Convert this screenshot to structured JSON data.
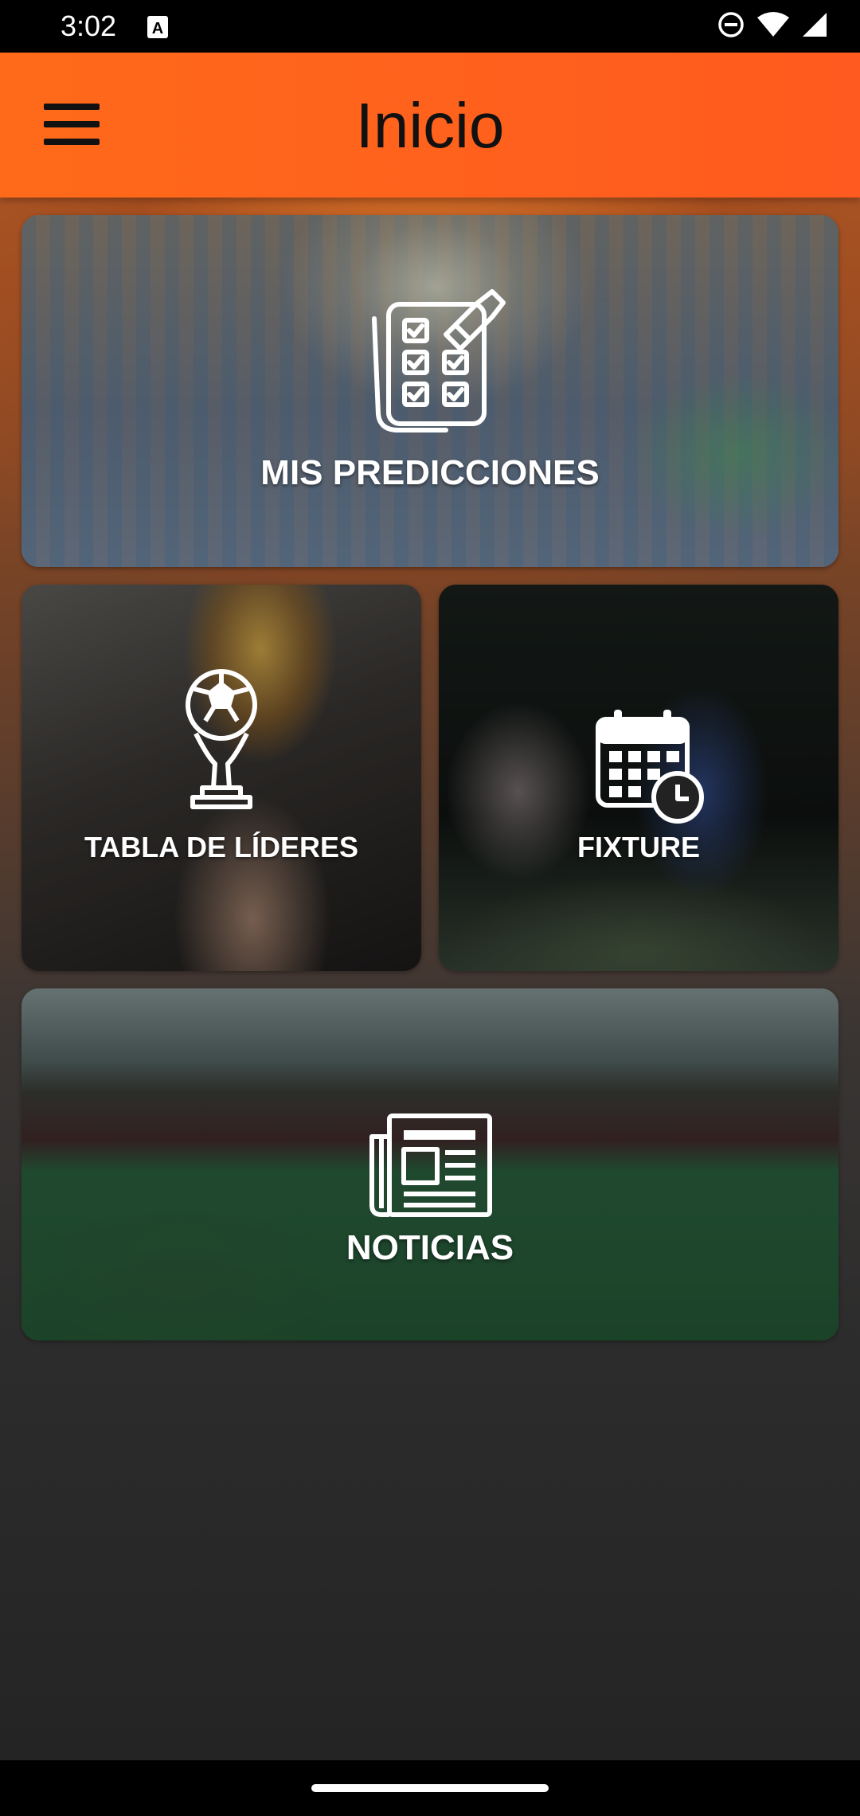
{
  "status_bar": {
    "time": "3:02",
    "icons": [
      "notification-a-icon",
      "do-not-disturb-icon",
      "wifi-icon",
      "signal-icon"
    ]
  },
  "app_bar": {
    "title": "Inicio",
    "menu_icon": "hamburger-menu-icon",
    "background_color": "#ff5a1f"
  },
  "tiles": {
    "predicciones": {
      "label": "MIS PREDICCIONES",
      "icon": "checklist-icon"
    },
    "lideres": {
      "label": "TABLA DE LÍDERES",
      "icon": "trophy-icon"
    },
    "fixture": {
      "label": "FIXTURE",
      "icon": "calendar-clock-icon"
    },
    "noticias": {
      "label": "NOTICIAS",
      "icon": "newspaper-icon"
    }
  },
  "nav_bar": {
    "handle": "home-gesture-handle"
  }
}
